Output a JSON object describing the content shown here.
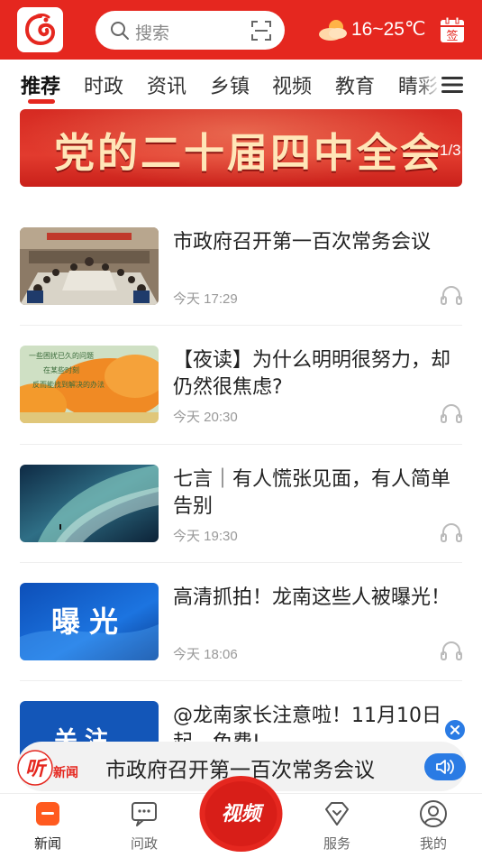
{
  "header": {
    "search_placeholder": "搜索",
    "temperature": "16~25℃",
    "calendar_label": "签"
  },
  "tabs": [
    {
      "label": "推荐",
      "active": true
    },
    {
      "label": "时政"
    },
    {
      "label": "资讯"
    },
    {
      "label": "乡镇"
    },
    {
      "label": "视频"
    },
    {
      "label": "教育"
    },
    {
      "label": "睛彩"
    }
  ],
  "banner": {
    "title": "党的二十届四中全会",
    "pager": "1/3"
  },
  "news": [
    {
      "title": "市政府召开第一百次常务会议",
      "time": "今天 17:29",
      "thumb": "meeting"
    },
    {
      "title": "【夜读】为什么明明很努力，却仍然很焦虑?",
      "time": "今天 20:30",
      "thumb": "autumn",
      "thumb_text": "一些困扰已久的问题，在某些时刻，反而能找到解决的办法"
    },
    {
      "title": "七言｜有人慌张见面，有人简单告别",
      "time": "今天 19:30",
      "thumb": "aurora"
    },
    {
      "title": "高清抓拍！龙南这些人被曝光！",
      "time": "今天 18:06",
      "thumb": "exposure",
      "thumb_text": "曝光"
    },
    {
      "title": "@龙南家长注意啦！11月10日起，免费!",
      "time": "",
      "thumb": "notice",
      "thumb_text": "关注"
    }
  ],
  "player": {
    "brand": "听新闻",
    "title": "市政府召开第一百次常务会议"
  },
  "bottom_nav": [
    {
      "label": "新闻",
      "active": true
    },
    {
      "label": "问政"
    },
    {
      "label": "视频"
    },
    {
      "label": "服务"
    },
    {
      "label": "我的"
    }
  ],
  "colors": {
    "brand_red": "#e5271f",
    "accent_blue": "#2a7be4"
  }
}
